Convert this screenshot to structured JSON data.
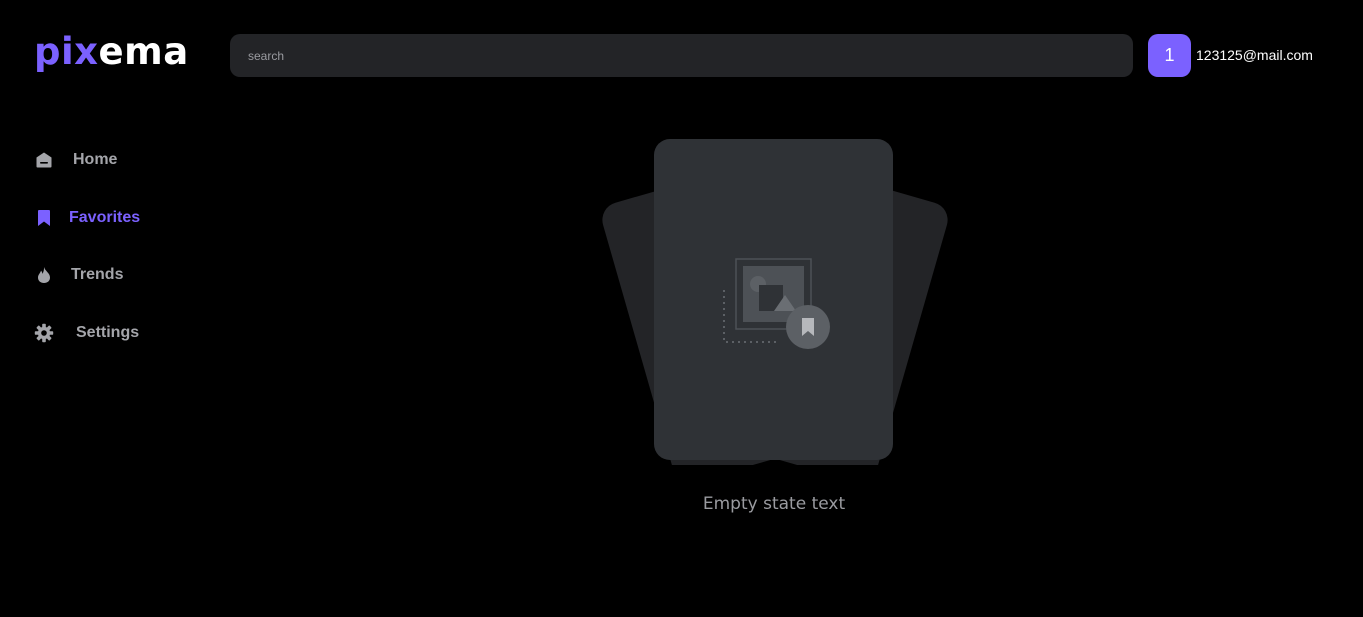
{
  "brand": {
    "logo_accent": "pix",
    "logo_rest": "ema",
    "accent_color": "#7b61ff"
  },
  "header": {
    "search_placeholder": "search",
    "user": {
      "avatar_initial": "1",
      "email": "123125@mail.com"
    }
  },
  "sidebar": {
    "items": [
      {
        "label": "Home",
        "icon": "home-icon",
        "active": false
      },
      {
        "label": "Favorites",
        "icon": "bookmark-icon",
        "active": true
      },
      {
        "label": "Trends",
        "icon": "flame-icon",
        "active": false
      },
      {
        "label": "Settings",
        "icon": "gear-icon",
        "active": false
      }
    ]
  },
  "main": {
    "empty_state_text": "Empty state text",
    "illustration_icon": "image-bookmark-icon"
  },
  "colors": {
    "background": "#000000",
    "surface": "#232427",
    "card": "#2f3236",
    "muted_text": "#a4a5aa"
  }
}
